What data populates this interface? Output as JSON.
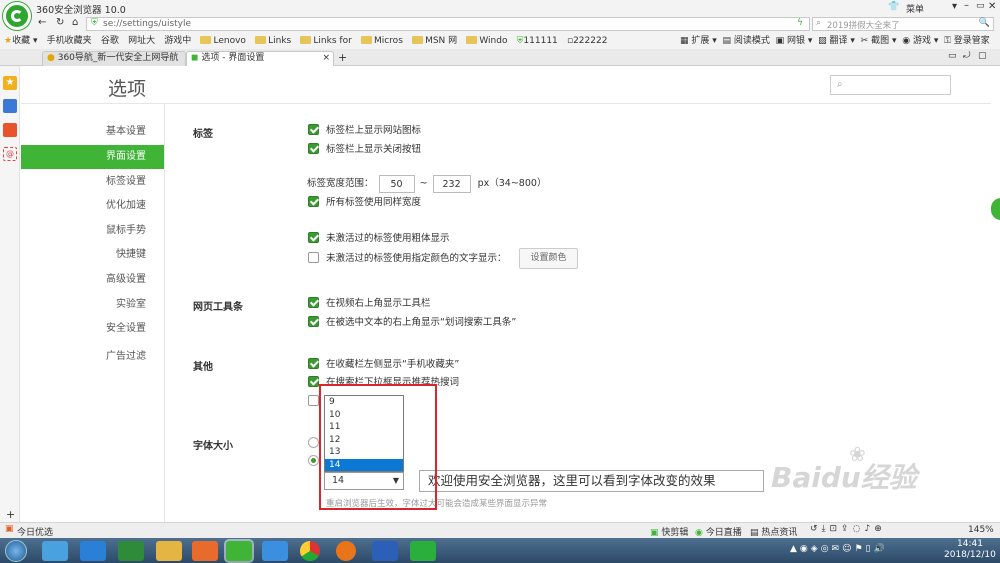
{
  "window": {
    "title": "360安全浏览器 10.0",
    "menu_label": "菜单"
  },
  "address": {
    "url": "se://settings/uistyle",
    "search_placeholder": "2019拼假大全来了"
  },
  "favorites": {
    "label": "收藏",
    "items": [
      "手机收藏夹",
      "谷歌",
      "网址大",
      "游戏中",
      "Lenovo",
      "Links",
      "Links for",
      "Micros",
      "MSN 网",
      "Windo",
      "111111",
      "222222"
    ],
    "right_items": [
      "扩展",
      "阅读模式",
      "网银",
      "翻译",
      "截图",
      "游戏",
      "登录管家"
    ]
  },
  "tabs": [
    {
      "label": "360导航_新一代安全上网导航"
    },
    {
      "label": "选项 - 界面设置"
    }
  ],
  "page": {
    "heading": "选项",
    "search_placeholder": ""
  },
  "sidebar": {
    "items": [
      "基本设置",
      "界面设置",
      "标签设置",
      "优化加速",
      "鼠标手势",
      "快捷键",
      "高级设置",
      "实验室",
      "安全设置",
      "广告过滤"
    ],
    "active_index": 1
  },
  "sections": {
    "tab": {
      "title": "标签",
      "opt1": "标签栏上显示网站图标",
      "opt2": "标签栏上显示关闭按钮",
      "width_label": "标签宽度范围：",
      "width_min": "50",
      "width_sep": "~",
      "width_max": "232",
      "width_unit": "px（34~800）",
      "opt3": "所有标签使用同样宽度",
      "opt4": "未激活过的标签使用粗体显示",
      "opt5": "未激活过的标签使用指定颜色的文字显示：",
      "color_button": "设置颜色"
    },
    "toolbar": {
      "title": "网页工具条",
      "opt1": "在视频右上角显示工具栏",
      "opt2": "在被选中文本的右上角显示“划词搜索工具条”"
    },
    "other": {
      "title": "其他",
      "opt1": "在收藏栏左侧显示“手机收藏夹”",
      "opt2": "在搜索栏下拉框显示推荐热搜词"
    },
    "font": {
      "title": "字体大小",
      "options": [
        "9",
        "10",
        "11",
        "12",
        "13",
        "14"
      ],
      "selected": "14",
      "preview": "欢迎使用安全浏览器，这里可以看到字体改变的效果",
      "note": "重启浏览器后生效，字体过大可能会造成某些界面显示异常"
    }
  },
  "status": {
    "left": "今日优选",
    "items": [
      "快剪辑",
      "今日直播",
      "热点资讯"
    ],
    "zoom": "145%"
  },
  "watermark": "Baidu经验",
  "taskbar": {
    "time": "14:41",
    "date": "2018/12/10"
  },
  "colors": {
    "accent": "#3fb436",
    "highlight": "#0b78d4",
    "red_box": "#d9262c"
  }
}
